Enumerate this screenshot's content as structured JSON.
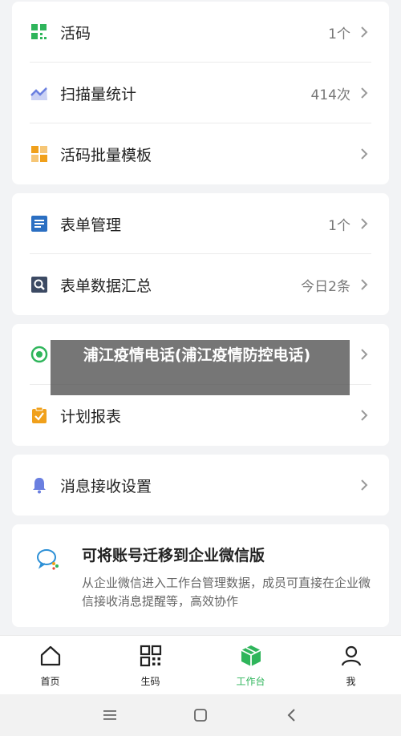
{
  "card1": {
    "items": [
      {
        "label": "活码",
        "value": "1个"
      },
      {
        "label": "扫描量统计",
        "value": "414次"
      },
      {
        "label": "活码批量模板",
        "value": ""
      }
    ]
  },
  "card2": {
    "items": [
      {
        "label": "表单管理",
        "value": "1个"
      },
      {
        "label": "表单数据汇总",
        "value": "今日2条"
      }
    ]
  },
  "card3": {
    "items": [
      {
        "label": "",
        "value": ""
      },
      {
        "label": "计划报表",
        "value": ""
      }
    ]
  },
  "card4": {
    "items": [
      {
        "label": "消息接收设置",
        "value": ""
      }
    ]
  },
  "overlay": {
    "text": "浦江疫情电话(浦江疫情防控电话)"
  },
  "promo": {
    "title": "可将账号迁移到企业微信版",
    "desc": "从企业微信进入工作台管理数据，成员可直接在企业微信接收消息提醒等，高效协作"
  },
  "tabbar": {
    "tabs": [
      {
        "label": "首页",
        "icon": "home-icon"
      },
      {
        "label": "生码",
        "icon": "qr-grid-icon"
      },
      {
        "label": "工作台",
        "icon": "workbench-box-icon"
      },
      {
        "label": "我",
        "icon": "user-icon"
      }
    ],
    "active": "工作台"
  },
  "colors": {
    "green": "#2fb55b",
    "blue": "#2b6fc2",
    "orange": "#f0a01b",
    "purple_blue": "#6a7fe0"
  }
}
